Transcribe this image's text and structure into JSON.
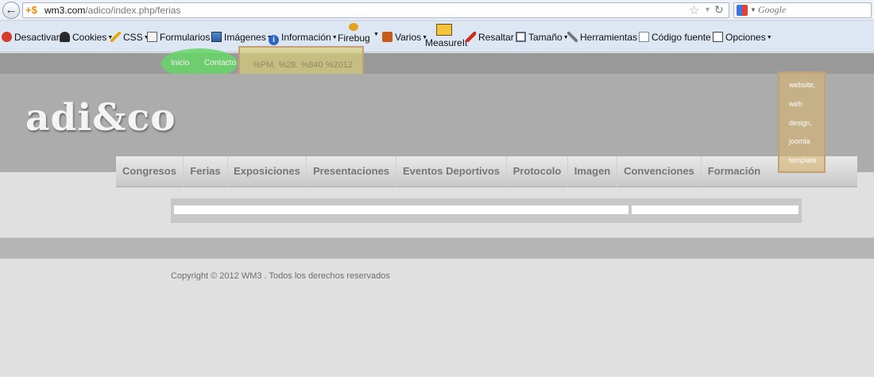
{
  "browser": {
    "url_domain": "wm3.com",
    "url_path": "/adico/index.php/ferias",
    "search_placeholder": "Google"
  },
  "toolbar": {
    "items": [
      {
        "label": "Desactivar",
        "icon": "disable-icon"
      },
      {
        "label": "Cookies",
        "icon": "cookies-icon"
      },
      {
        "label": "CSS",
        "icon": "css-pencil-icon"
      },
      {
        "label": "Formularios",
        "icon": "forms-icon"
      },
      {
        "label": "Imágenes",
        "icon": "images-icon"
      },
      {
        "label": "Información",
        "icon": "info-icon"
      },
      {
        "label": "Firebug",
        "icon": "firebug-icon"
      },
      {
        "label": "Varios",
        "icon": "misc-icon"
      },
      {
        "label": "MeasureIt",
        "icon": "ruler-icon"
      },
      {
        "label": "Resaltar",
        "icon": "highlight-icon"
      },
      {
        "label": "Tamaño",
        "icon": "resize-icon"
      },
      {
        "label": "Herramientas",
        "icon": "tools-icon"
      },
      {
        "label": "Código fuente",
        "icon": "source-icon"
      },
      {
        "label": "Opciones",
        "icon": "options-icon"
      }
    ]
  },
  "site": {
    "top_nav": [
      {
        "label": "Inicio"
      },
      {
        "label": "Contacto"
      }
    ],
    "date_text": "%PM, %28. %840 %2012",
    "logo": "adi&co",
    "menu": [
      {
        "label": "Congresos"
      },
      {
        "label": "Ferias"
      },
      {
        "label": "Exposiciones"
      },
      {
        "label": "Presentaciones"
      },
      {
        "label": "Eventos Deportivos"
      },
      {
        "label": "Protocolo"
      },
      {
        "label": "Imagen"
      },
      {
        "label": "Convenciones"
      },
      {
        "label": "Formación"
      }
    ],
    "tags": [
      "website,",
      "web",
      "design,",
      "joomla",
      "template"
    ],
    "copyright": "Copyright © 2012 WM3 . Todos los derechos reservados"
  },
  "colors": {
    "nav_highlight": "#66d666",
    "annotation_box": "#d8cc78",
    "menu_text": "#767676"
  }
}
